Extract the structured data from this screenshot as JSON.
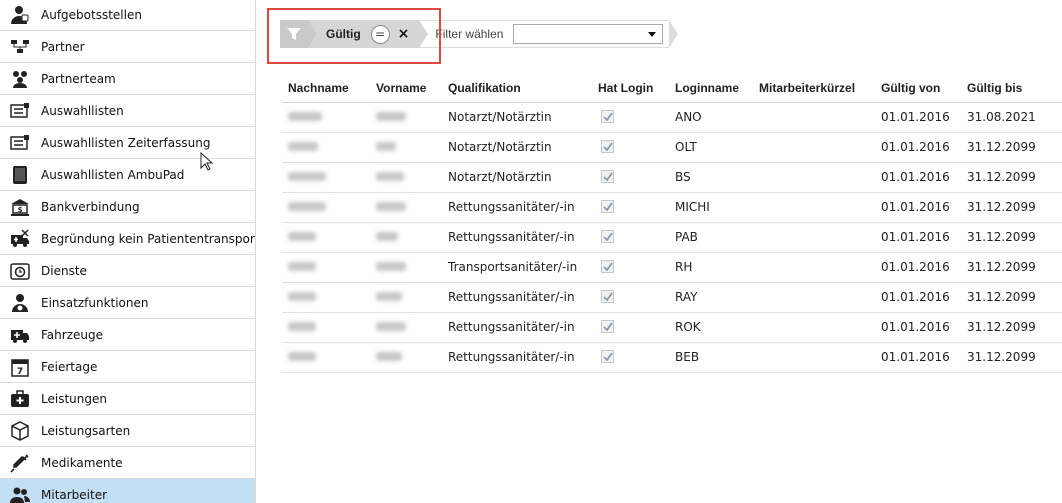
{
  "sidebar": {
    "items": [
      {
        "label": "Aufgebotsstellen",
        "icon": "person-phone-icon"
      },
      {
        "label": "Partner",
        "icon": "partner-network-icon"
      },
      {
        "label": "Partnerteam",
        "icon": "team-icon"
      },
      {
        "label": "Auswahllisten",
        "icon": "list-icon"
      },
      {
        "label": "Auswahllisten Zeiterfassung",
        "icon": "list-icon"
      },
      {
        "label": "Auswahllisten AmbuPad",
        "icon": "tablet-icon"
      },
      {
        "label": "Bankverbindung",
        "icon": "bank-icon"
      },
      {
        "label": "Begründung kein Patiententranspor",
        "icon": "ambulance-denied-icon"
      },
      {
        "label": "Dienste",
        "icon": "clock-icon"
      },
      {
        "label": "Einsatzfunktionen",
        "icon": "person-medical-icon"
      },
      {
        "label": "Fahrzeuge",
        "icon": "ambulance-icon"
      },
      {
        "label": "Feiertage",
        "icon": "calendar-icon"
      },
      {
        "label": "Leistungen",
        "icon": "medical-kit-icon"
      },
      {
        "label": "Leistungsarten",
        "icon": "box-icon"
      },
      {
        "label": "Medikamente",
        "icon": "syringe-icon"
      },
      {
        "label": "Mitarbeiter",
        "icon": "people-icon",
        "active": true
      }
    ]
  },
  "filter": {
    "chip_name": "Gültig",
    "operator": "=",
    "remove": "×",
    "add_label": "Filter wählen",
    "select_value": ""
  },
  "table": {
    "columns": [
      "Nachname",
      "Vorname",
      "Qualifikation",
      "Hat Login",
      "Loginname",
      "Mitarbeiterkürzel",
      "Gültig von",
      "Gültig bis"
    ],
    "rows": [
      {
        "qualifikation": "Notarzt/Notärztin",
        "login": true,
        "loginname": "ANO",
        "kuerzel": "",
        "von": "01.01.2016",
        "bis": "31.08.2021"
      },
      {
        "qualifikation": "Notarzt/Notärztin",
        "login": true,
        "loginname": "OLT",
        "kuerzel": "",
        "von": "01.01.2016",
        "bis": "31.12.2099"
      },
      {
        "qualifikation": "Notarzt/Notärztin",
        "login": true,
        "loginname": "BS",
        "kuerzel": "",
        "von": "01.01.2016",
        "bis": "31.12.2099"
      },
      {
        "qualifikation": "Rettungssanitäter/-in",
        "login": true,
        "loginname": "MICHI",
        "kuerzel": "",
        "von": "01.01.2016",
        "bis": "31.12.2099"
      },
      {
        "qualifikation": "Rettungssanitäter/-in",
        "login": true,
        "loginname": "PAB",
        "kuerzel": "",
        "von": "01.01.2016",
        "bis": "31.12.2099"
      },
      {
        "qualifikation": "Transportsanitäter/-in",
        "login": true,
        "loginname": "RH",
        "kuerzel": "",
        "von": "01.01.2016",
        "bis": "31.12.2099"
      },
      {
        "qualifikation": "Rettungssanitäter/-in",
        "login": true,
        "loginname": "RAY",
        "kuerzel": "",
        "von": "01.01.2016",
        "bis": "31.12.2099"
      },
      {
        "qualifikation": "Rettungssanitäter/-in",
        "login": true,
        "loginname": "ROK",
        "kuerzel": "",
        "von": "01.01.2016",
        "bis": "31.12.2099"
      },
      {
        "qualifikation": "Rettungssanitäter/-in",
        "login": true,
        "loginname": "BEB",
        "kuerzel": "",
        "von": "01.01.2016",
        "bis": "31.12.2099"
      }
    ]
  },
  "colors": {
    "active_item": "#c3dff3",
    "highlight_box": "#e0473f",
    "chip_bg": "#d6d6d6"
  }
}
